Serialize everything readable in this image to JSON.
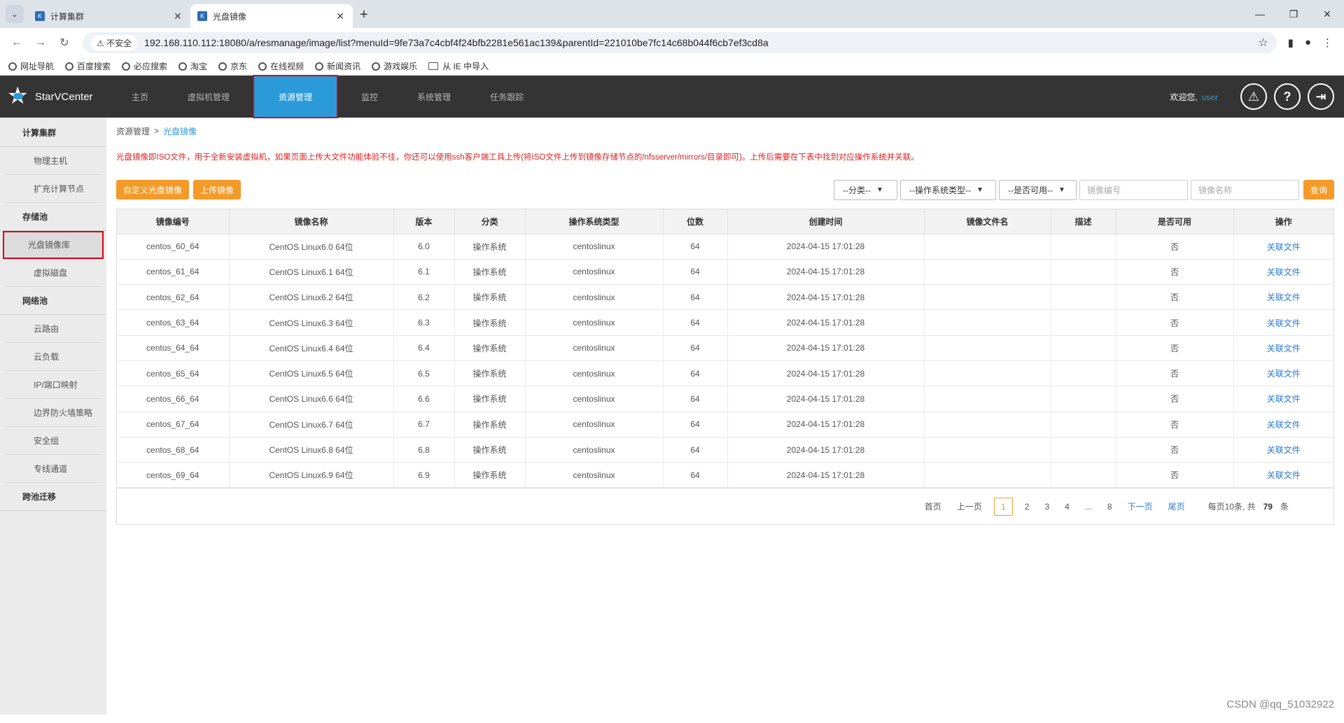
{
  "browser": {
    "tabs": [
      {
        "title": "计算集群",
        "active": false
      },
      {
        "title": "光盘镜像",
        "active": true
      }
    ],
    "insecure_label": "不安全",
    "url": "192.168.110.112:18080/a/resmanage/image/list?menuId=9fe73a7c4cbf4f24bfb2281e561ac139&parentId=221010be7fc14c68b044f6cb7ef3cd8a",
    "bookmarks": [
      "网址导航",
      "百度搜索",
      "必应搜索",
      "淘宝",
      "京东",
      "在线视频",
      "新闻资讯",
      "游戏娱乐",
      "从 IE 中导入"
    ]
  },
  "header": {
    "brand": "StarVCenter",
    "nav": [
      "主页",
      "虚拟机管理",
      "资源管理",
      "监控",
      "系统管理",
      "任务跟踪"
    ],
    "active_nav": "资源管理",
    "welcome": "欢迎您,",
    "username": "user"
  },
  "sidebar": {
    "items": [
      {
        "label": "计算集群",
        "group": true
      },
      {
        "label": "物理主机",
        "group": false
      },
      {
        "label": "扩充计算节点",
        "group": false
      },
      {
        "label": "存储池",
        "group": true
      },
      {
        "label": "光盘镜像库",
        "group": false,
        "active": true
      },
      {
        "label": "虚拟磁盘",
        "group": false
      },
      {
        "label": "网络池",
        "group": true
      },
      {
        "label": "云路由",
        "group": false
      },
      {
        "label": "云负载",
        "group": false
      },
      {
        "label": "IP/端口映射",
        "group": false
      },
      {
        "label": "边界防火墙策略",
        "group": false
      },
      {
        "label": "安全组",
        "group": false
      },
      {
        "label": "专线通道",
        "group": false
      },
      {
        "label": "跨池迁移",
        "group": true
      }
    ]
  },
  "breadcrumb": {
    "parent": "资源管理",
    "sep": ">",
    "current": "光盘镜像"
  },
  "notice": "光盘镜像即ISO文件，用于全新安装虚拟机，如果页面上传大文件功能体验不佳，你还可以使用ssh客户端工具上传(将ISO文件上传到镜像存储节点的/nfsserver/mirrors/目录即可)。上传后需要在下表中找到对应操作系统并关联。",
  "toolbar": {
    "custom_button": "自定义光盘镜像",
    "upload_button": "上传镜像",
    "category_select": "--分类--",
    "os_select": "--操作系统类型--",
    "available_select": "--是否可用--",
    "code_placeholder": "镜像编号",
    "name_placeholder": "镜像名称",
    "query_button": "查询"
  },
  "table": {
    "columns": [
      "镜像编号",
      "镜像名称",
      "版本",
      "分类",
      "操作系统类型",
      "位数",
      "创建时间",
      "镜像文件名",
      "描述",
      "是否可用",
      "操作"
    ],
    "rows": [
      [
        "centos_60_64",
        "CentOS Linux6.0 64位",
        "6.0",
        "操作系统",
        "centoslinux",
        "64",
        "2024-04-15 17:01:28",
        "",
        "",
        "否",
        "关联文件"
      ],
      [
        "centos_61_64",
        "CentOS Linux6.1 64位",
        "6.1",
        "操作系统",
        "centoslinux",
        "64",
        "2024-04-15 17:01:28",
        "",
        "",
        "否",
        "关联文件"
      ],
      [
        "centos_62_64",
        "CentOS Linux6.2 64位",
        "6.2",
        "操作系统",
        "centoslinux",
        "64",
        "2024-04-15 17:01:28",
        "",
        "",
        "否",
        "关联文件"
      ],
      [
        "centos_63_64",
        "CentOS Linux6.3 64位",
        "6.3",
        "操作系统",
        "centoslinux",
        "64",
        "2024-04-15 17:01:28",
        "",
        "",
        "否",
        "关联文件"
      ],
      [
        "centos_64_64",
        "CentOS Linux6.4 64位",
        "6.4",
        "操作系统",
        "centoslinux",
        "64",
        "2024-04-15 17:01:28",
        "",
        "",
        "否",
        "关联文件"
      ],
      [
        "centos_65_64",
        "CentOS Linux6.5 64位",
        "6.5",
        "操作系统",
        "centoslinux",
        "64",
        "2024-04-15 17:01:28",
        "",
        "",
        "否",
        "关联文件"
      ],
      [
        "centos_66_64",
        "CentOS Linux6.6 64位",
        "6.6",
        "操作系统",
        "centoslinux",
        "64",
        "2024-04-15 17:01:28",
        "",
        "",
        "否",
        "关联文件"
      ],
      [
        "centos_67_64",
        "CentOS Linux6.7 64位",
        "6.7",
        "操作系统",
        "centoslinux",
        "64",
        "2024-04-15 17:01:28",
        "",
        "",
        "否",
        "关联文件"
      ],
      [
        "centos_68_64",
        "CentOS Linux6.8 64位",
        "6.8",
        "操作系统",
        "centoslinux",
        "64",
        "2024-04-15 17:01:28",
        "",
        "",
        "否",
        "关联文件"
      ],
      [
        "centos_69_64",
        "CentOS Linux6.9 64位",
        "6.9",
        "操作系统",
        "centoslinux",
        "64",
        "2024-04-15 17:01:28",
        "",
        "",
        "否",
        "关联文件"
      ]
    ]
  },
  "pager": {
    "first": "首页",
    "prev": "上一页",
    "pages": [
      "1",
      "2",
      "3",
      "4",
      "...",
      "8"
    ],
    "current": "1",
    "next": "下一页",
    "last": "尾页",
    "summary_prefix": "每页10条, 共",
    "total": "79",
    "summary_suffix": "条"
  },
  "watermark": "CSDN @qq_51032922",
  "colors": {
    "accent": "#2b9ad8",
    "orange": "#f39a28",
    "notice_red": "#e02020",
    "highlight_red": "#d0021b",
    "header_bg": "#343434"
  }
}
